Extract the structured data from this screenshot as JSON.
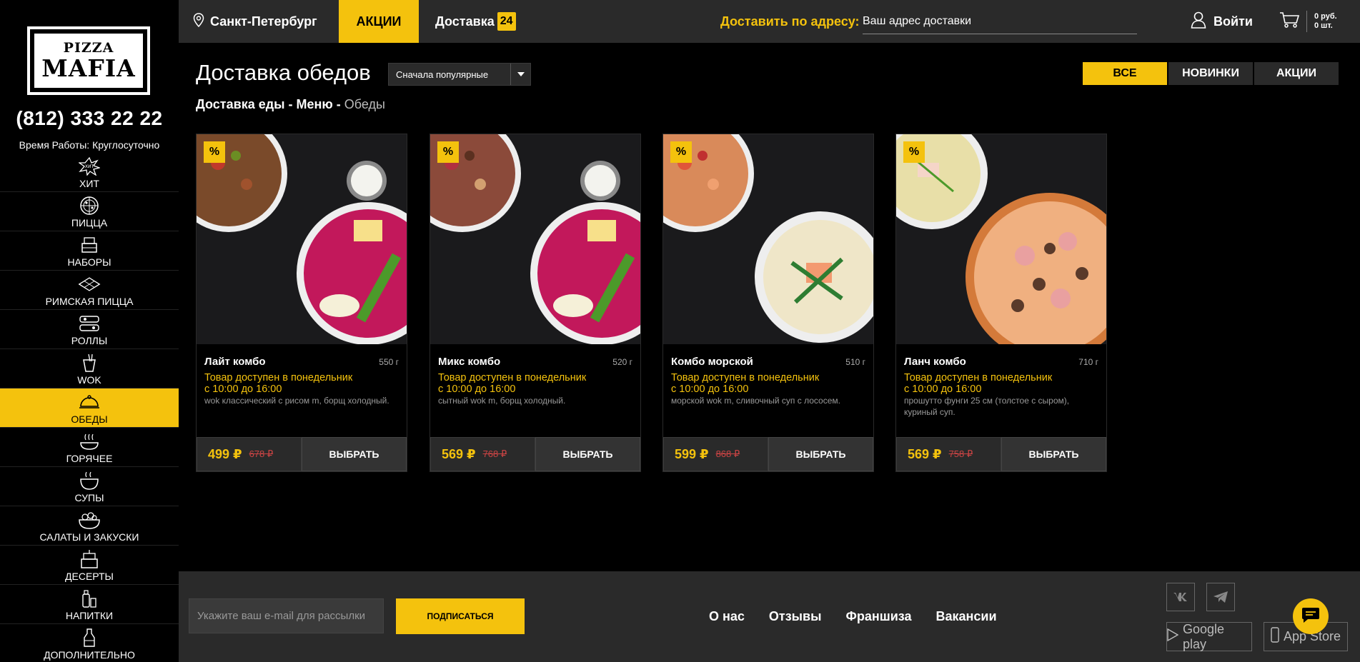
{
  "brand": {
    "logo_line1": "PIZZA",
    "logo_line2": "MAFIA",
    "phone": "(812) 333 22 22",
    "hours": "Время Работы: Круглосуточно"
  },
  "nav": [
    {
      "label": "Хит",
      "icon": "hit-icon",
      "active": false
    },
    {
      "label": "Пицца",
      "icon": "pizza-icon",
      "active": false
    },
    {
      "label": "Наборы",
      "icon": "sets-icon",
      "active": false
    },
    {
      "label": "Римская пицца",
      "icon": "roman-pizza-icon",
      "active": false
    },
    {
      "label": "Роллы",
      "icon": "rolls-icon",
      "active": false
    },
    {
      "label": "WOK",
      "icon": "wok-icon",
      "active": false
    },
    {
      "label": "Обеды",
      "icon": "lunch-cloche-icon",
      "active": true
    },
    {
      "label": "Горячее",
      "icon": "hot-dish-icon",
      "active": false
    },
    {
      "label": "Супы",
      "icon": "soup-icon",
      "active": false
    },
    {
      "label": "Салаты и закуски",
      "icon": "salad-icon",
      "active": false
    },
    {
      "label": "Десерты",
      "icon": "dessert-icon",
      "active": false
    },
    {
      "label": "Напитки",
      "icon": "drinks-icon",
      "active": false
    },
    {
      "label": "Дополнительно",
      "icon": "extra-icon",
      "active": false
    }
  ],
  "header": {
    "city": "Санкт-Петербург",
    "promo": "АКЦИИ",
    "delivery": "Доставка",
    "delivery_badge": "24",
    "address_label": "Доставить по адресу:",
    "address_placeholder": "Ваш адрес доставки",
    "login": "Войти",
    "cart_sum": "0 руб.",
    "cart_count": "0 шт."
  },
  "main": {
    "title": "Доставка обедов",
    "sort": "Сначала популярные",
    "filters": [
      "ВСЕ",
      "НОВИНКИ",
      "АКЦИИ"
    ],
    "breadcrumb": {
      "a": "Доставка еды",
      "sep": " - ",
      "b": "Меню",
      "c": "Обеды"
    }
  },
  "products": [
    {
      "name": "Лайт комбо",
      "weight": "550 г",
      "avail1": "Товар доступен в понедельник",
      "avail2": " с 10:00 до 16:00",
      "desc": "wok классический с рисом m, борщ холодный.",
      "price": "499 ₽",
      "old_price": "678 ₽",
      "button": "ВЫБРАТЬ",
      "promo_badge": "%"
    },
    {
      "name": "Микс комбо",
      "weight": "520 г",
      "avail1": "Товар доступен в понедельник",
      "avail2": " с 10:00 до 16:00",
      "desc": "сытный wok m, борщ холодный.",
      "price": "569 ₽",
      "old_price": "768 ₽",
      "button": "ВЫБРАТЬ",
      "promo_badge": "%"
    },
    {
      "name": "Комбо морской",
      "weight": "510 г",
      "avail1": "Товар доступен в понедельник",
      "avail2": " с 10:00 до 16:00",
      "desc": "морской wok m, сливочный суп с лососем.",
      "price": "599 ₽",
      "old_price": "868 ₽",
      "button": "ВЫБРАТЬ",
      "promo_badge": "%"
    },
    {
      "name": "Ланч комбо",
      "weight": "710 г",
      "avail1": "Товар доступен в понедельник",
      "avail2": " с 10:00 до 16:00",
      "desc": "прошутто фунги 25 см (толстое с сыром), куриный суп.",
      "price": "569 ₽",
      "old_price": "758 ₽",
      "button": "ВЫБРАТЬ",
      "promo_badge": "%"
    }
  ],
  "footer": {
    "email_placeholder": "Укажите ваш e-mail для рассылки",
    "subscribe": "Подписаться",
    "links": [
      "О нас",
      "Отзывы",
      "Франшиза",
      "Вакансии"
    ],
    "google_play": "Google play",
    "app_store": "App Store"
  },
  "colors": {
    "accent": "#f4c20d",
    "panel": "#2a2a2a",
    "old_price": "#cc4444"
  }
}
